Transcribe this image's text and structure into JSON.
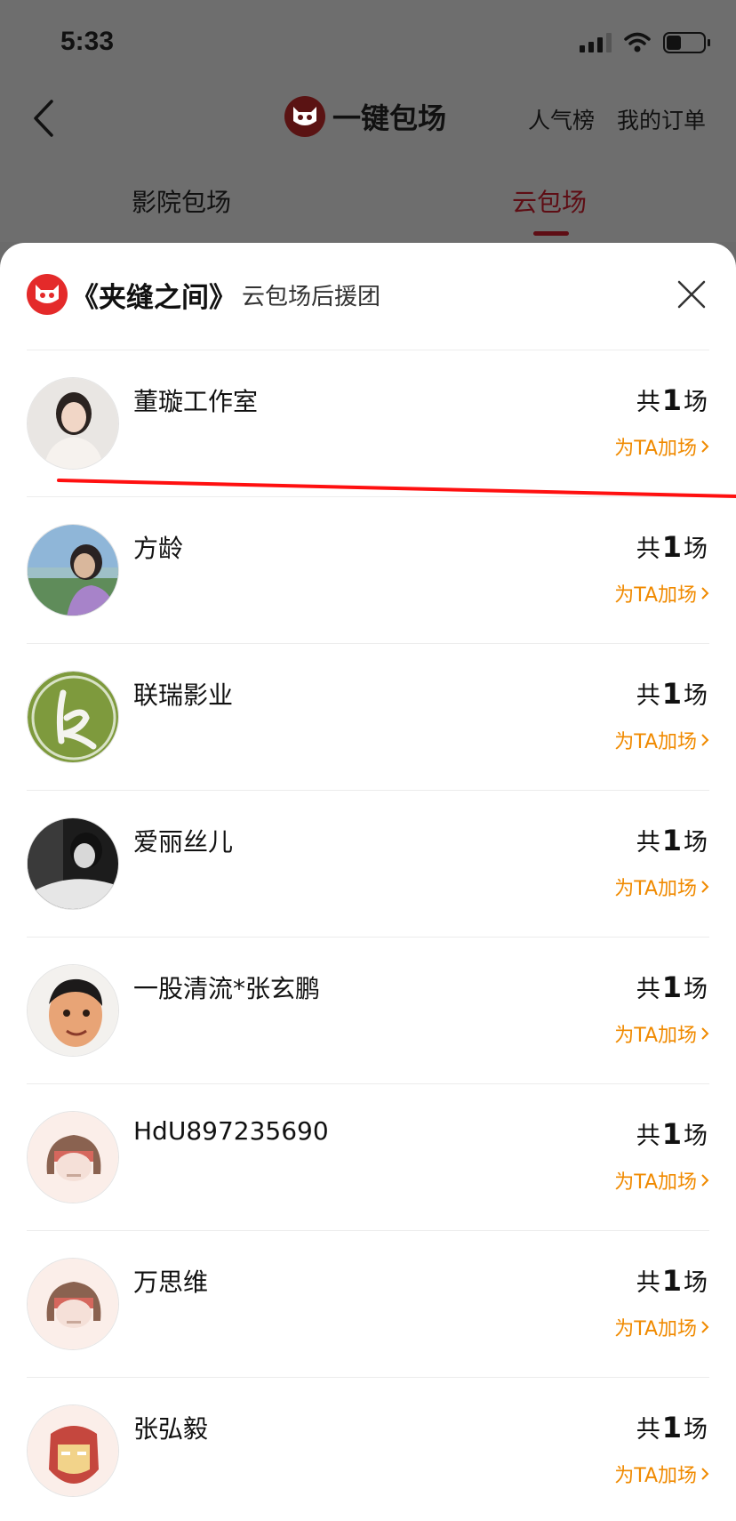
{
  "status": {
    "time": "5:33"
  },
  "header": {
    "title": "一键包场",
    "links": {
      "rank": "人气榜",
      "orders": "我的订单"
    },
    "tabs": {
      "cinema": "影院包场",
      "cloud": "云包场"
    }
  },
  "sheet": {
    "movie": "《夹缝之间》",
    "subtitle": "云包场后援团",
    "count_prefix": "共",
    "count_suffix": "场",
    "add_label": "为TA加场",
    "rows": [
      {
        "name": "董璇工作室",
        "count": "1"
      },
      {
        "name": "方龄",
        "count": "1"
      },
      {
        "name": "联瑞影业",
        "count": "1"
      },
      {
        "name": "爱丽丝儿",
        "count": "1"
      },
      {
        "name": "一股清流*张玄鹏",
        "count": "1"
      },
      {
        "name": "HdU897235690",
        "count": "1"
      },
      {
        "name": "万思维",
        "count": "1"
      },
      {
        "name": "张弘毅",
        "count": "1"
      }
    ]
  },
  "colors": {
    "accent": "#f08a00",
    "brand_red": "#e42a2a",
    "annotation_red": "#ff1010"
  }
}
